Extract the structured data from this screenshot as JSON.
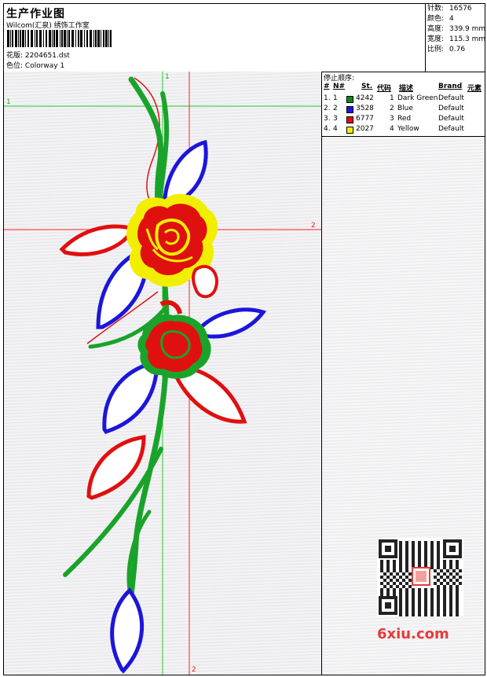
{
  "header": {
    "title": "生产作业图",
    "company": "Wilcom(汇泉) 绣饰工作室",
    "design_label": "花版:",
    "design_value": "2204651.dst",
    "colorway_label": "色位:",
    "colorway_value": "Colorway 1"
  },
  "stats": [
    {
      "label": "针数:",
      "value": "16576"
    },
    {
      "label": "颜色:",
      "value": "4"
    },
    {
      "label": "高度:",
      "value": "339.9 mm"
    },
    {
      "label": "宽度:",
      "value": "115.3 mm"
    },
    {
      "label": "比例:",
      "value": "0.76"
    }
  ],
  "guides": {
    "v1": "1",
    "h1": "1",
    "h2": "2",
    "v2": "2"
  },
  "sequence": {
    "title": "停止顺序:",
    "columns": {
      "stop": "#",
      "n": "N#",
      "st": "St.",
      "code": "代码",
      "desc": "描述",
      "brand": "Brand",
      "elem": "元素"
    },
    "rows": [
      {
        "stop": "1.",
        "n": "1",
        "color": "#0b8a1a",
        "st": "4242",
        "code": "1",
        "desc": "Dark Green",
        "brand": "Default"
      },
      {
        "stop": "2.",
        "n": "2",
        "color": "#1c16d9",
        "st": "3528",
        "code": "2",
        "desc": "Blue",
        "brand": "Default"
      },
      {
        "stop": "3.",
        "n": "3",
        "color": "#e01010",
        "st": "6777",
        "code": "3",
        "desc": "Red",
        "brand": "Default"
      },
      {
        "stop": "4.",
        "n": "4",
        "color": "#f2ee00",
        "st": "2027",
        "code": "4",
        "desc": "Yellow",
        "brand": "Default"
      }
    ]
  },
  "watermark": {
    "site": "6xiu.com"
  },
  "colors": {
    "green": "#1aa32a",
    "blue": "#1c16d9",
    "red": "#e01010",
    "yellow": "#f2ee00",
    "guide_green": "#22cc22",
    "guide_red": "#ff2222"
  }
}
